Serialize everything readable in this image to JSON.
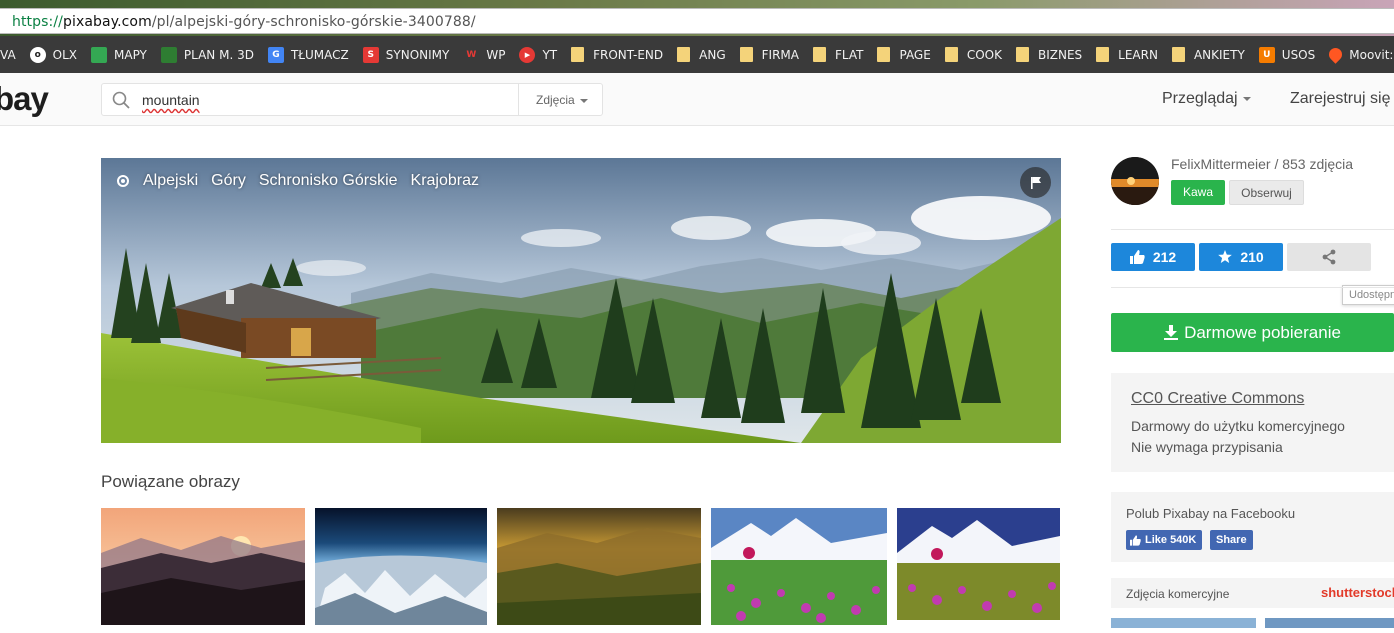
{
  "browser": {
    "url_scheme": "https://",
    "url_host": "pixabay.com",
    "url_path": "/pl/alpejski-góry-schronisko-górskie-3400788/"
  },
  "bookmarks": [
    {
      "label": "VA",
      "icon": "none",
      "color": ""
    },
    {
      "label": "OLX",
      "icon": "olx-icon",
      "color": "#ffffff"
    },
    {
      "label": "MAPY",
      "icon": "maps-icon",
      "color": "#34a853"
    },
    {
      "label": "PLAN M. 3D",
      "icon": "chart-icon",
      "color": "#2e7d32"
    },
    {
      "label": "TŁUMACZ",
      "icon": "translate-icon",
      "color": "#4285f4"
    },
    {
      "label": "SYNONIMY",
      "icon": "s-icon",
      "color": "#e53935"
    },
    {
      "label": "WP",
      "icon": "wp-icon",
      "color": "#e53935"
    },
    {
      "label": "YT",
      "icon": "youtube-icon",
      "color": "#e53935"
    },
    {
      "label": "FRONT-END",
      "icon": "folder-icon",
      "color": "#f4d37a"
    },
    {
      "label": "ANG",
      "icon": "folder-icon",
      "color": "#f4d37a"
    },
    {
      "label": "FIRMA",
      "icon": "folder-icon",
      "color": "#f4d37a"
    },
    {
      "label": "FLAT",
      "icon": "folder-icon",
      "color": "#f4d37a"
    },
    {
      "label": "PAGE",
      "icon": "folder-icon",
      "color": "#f4d37a"
    },
    {
      "label": "COOK",
      "icon": "folder-icon",
      "color": "#f4d37a"
    },
    {
      "label": "BIZNES",
      "icon": "folder-icon",
      "color": "#f4d37a"
    },
    {
      "label": "LEARN",
      "icon": "folder-icon",
      "color": "#f4d37a"
    },
    {
      "label": "ANKIETY",
      "icon": "folder-icon",
      "color": "#f4d37a"
    },
    {
      "label": "USOS",
      "icon": "u-icon",
      "color": "#f57c00"
    },
    {
      "label": "Moovit: Komunikac",
      "icon": "pin-icon",
      "color": "#ff5722"
    }
  ],
  "header": {
    "logo": "bay",
    "search_value": "mountain",
    "search_type": "Zdjęcia",
    "browse": "Przeglądaj",
    "register": "Zarejestruj się"
  },
  "hero": {
    "tags": [
      "Alpejski",
      "Góry",
      "Schronisko Górskie",
      "Krajobraz"
    ]
  },
  "related": {
    "title": "Powiązane obrazy"
  },
  "sidebar": {
    "author": "FelixMittermeier / 853 zdjęcia",
    "coffee": "Kawa",
    "follow": "Obserwuj",
    "likes": "212",
    "favorites": "210",
    "share_tooltip": "Udostępn",
    "download": "Darmowe pobieranie",
    "license_title": "CC0 Creative Commons",
    "license_line1": "Darmowy do użytku komercyjnego",
    "license_line2": "Nie wymaga przypisania",
    "facebook_title": "Polub Pixabay na Facebooku",
    "fb_like": "Like 540K",
    "fb_share": "Share",
    "commercial": "Zdjęcia komercyjne",
    "shutterstock": "shutterstock"
  },
  "colors": {
    "green": "#2ab44c",
    "blue": "#1d87db",
    "facebook": "#4267b2"
  }
}
